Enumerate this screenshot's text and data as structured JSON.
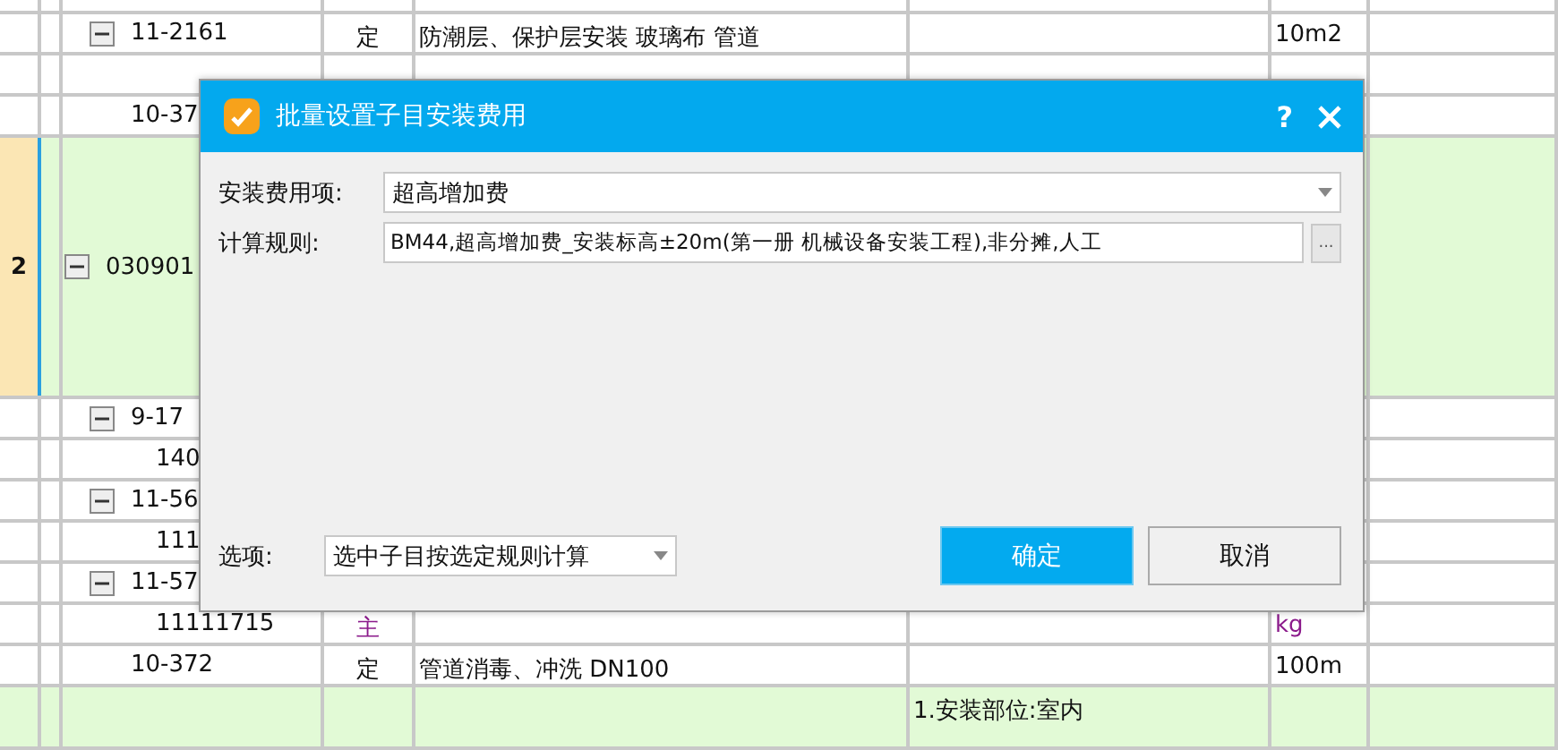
{
  "grid": {
    "rows": [
      {
        "kind": "partial",
        "selected": false
      },
      {
        "kind": "item",
        "selected": false,
        "code": "11-2161",
        "type": "定",
        "name": "防潮层、保护层安装 玻璃布 管道",
        "unit": "10m2",
        "expanded": true,
        "children": [
          {
            "kind": "material"
          }
        ]
      },
      {
        "kind": "item",
        "selected": false,
        "code": "10-37"
      },
      {
        "kind": "group",
        "selected": true,
        "number": "2",
        "code": "030901",
        "expanded": true,
        "children": [
          {
            "kind": "item",
            "code": "9-17",
            "expanded": true,
            "children": [
              {
                "kind": "material",
                "code": "140"
              }
            ]
          },
          {
            "kind": "item",
            "code": "11-56",
            "expanded": true,
            "children": [
              {
                "kind": "material",
                "code": "111"
              }
            ]
          },
          {
            "kind": "item",
            "code": "11-57",
            "expanded": true,
            "children": [
              {
                "kind": "material",
                "code": "11111715",
                "type": "主",
                "unit": "kg"
              }
            ]
          },
          {
            "kind": "item",
            "code": "10-372",
            "type": "定",
            "name": "管道消毒、冲洗 DN100",
            "unit": "100m"
          }
        ]
      },
      {
        "kind": "group",
        "selected": false,
        "feature": "1.安装部位:室内"
      }
    ]
  },
  "dialog": {
    "title": "批量设置子目安装费用",
    "help": "?",
    "fee_label": "安装费用项:",
    "fee_value": "超高增加费",
    "rule_label": "计算规则:",
    "rule_value": "BM44,超高增加费_安装标高±20m(第一册 机械设备安装工程),非分摊,人工",
    "browse": "...",
    "option_label": "选项:",
    "option_value": "选中子目按选定规则计算",
    "ok": "确定",
    "cancel": "取消"
  }
}
